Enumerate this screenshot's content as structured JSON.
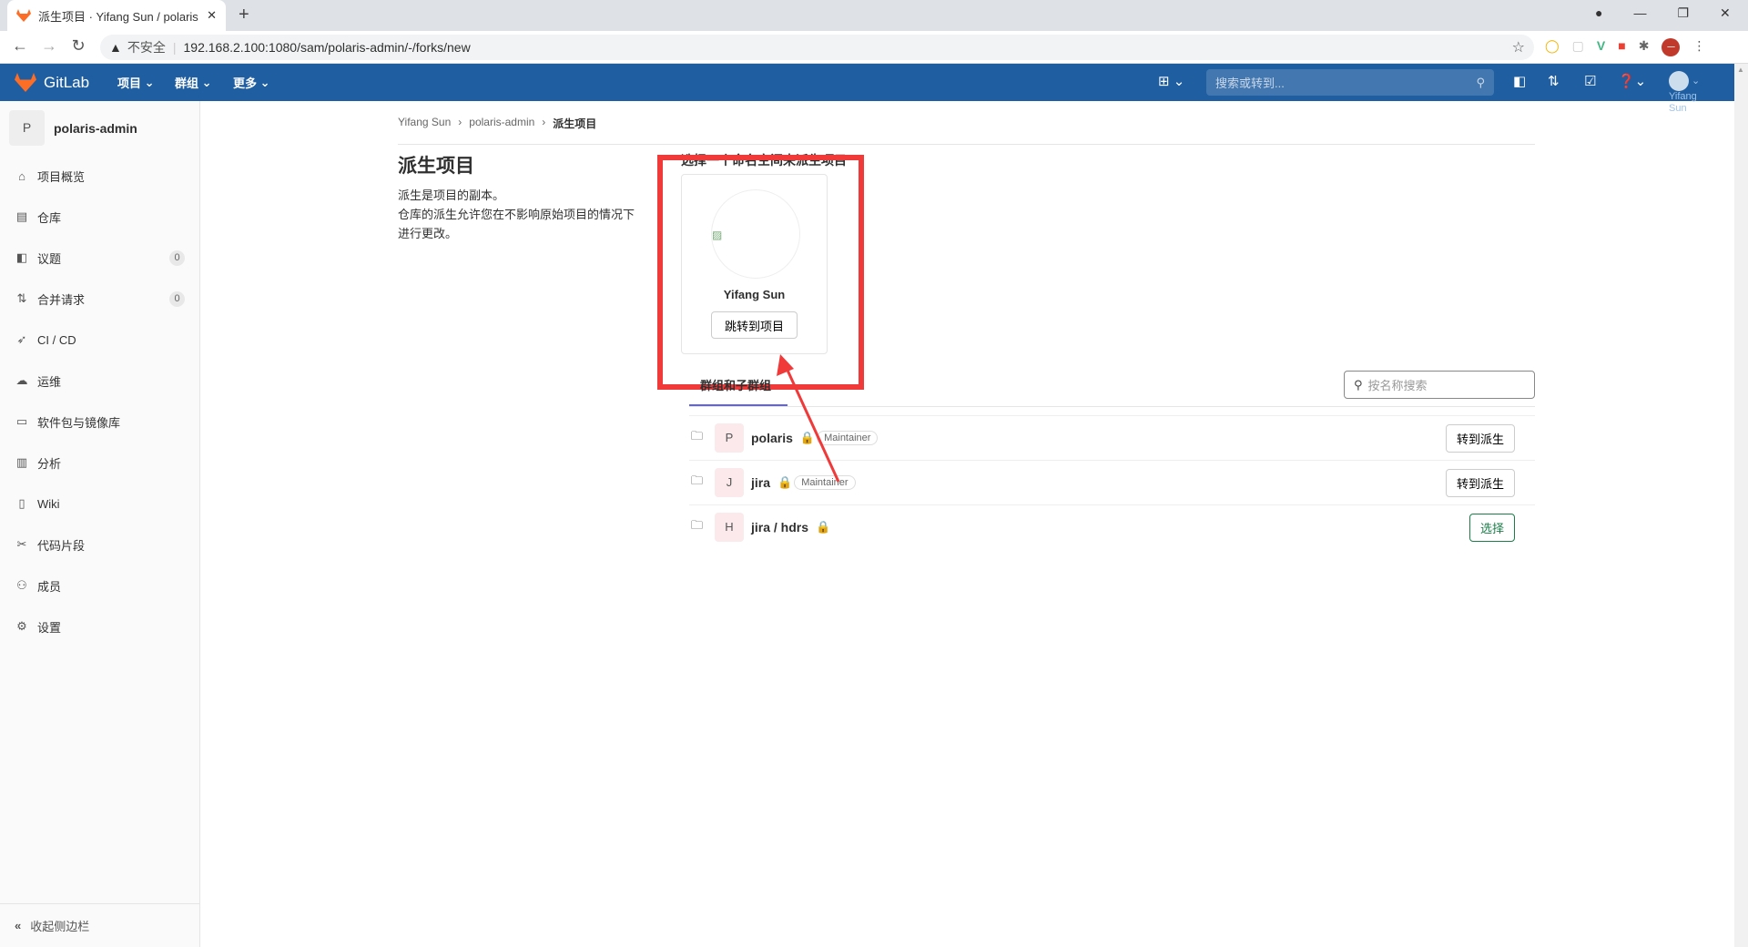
{
  "browser": {
    "tab_title": "派生项目 · Yifang Sun / polaris",
    "security": "不安全",
    "url": "192.168.2.100:1080/sam/polaris-admin/-/forks/new"
  },
  "header": {
    "brand": "GitLab",
    "menus": [
      "项目",
      "群组",
      "更多"
    ],
    "search_placeholder": "搜索或转到...",
    "user": "Yifang Sun"
  },
  "sidebar": {
    "project_letter": "P",
    "project_name": "polaris-admin",
    "items": [
      {
        "label": "项目概览",
        "icon": "home-icon"
      },
      {
        "label": "仓库",
        "icon": "doc-icon"
      },
      {
        "label": "议题",
        "icon": "issues-icon",
        "count": "0"
      },
      {
        "label": "合并请求",
        "icon": "merge-request-icon",
        "count": "0"
      },
      {
        "label": "CI / CD",
        "icon": "rocket-icon"
      },
      {
        "label": "运维",
        "icon": "cloud-icon"
      },
      {
        "label": "软件包与镜像库",
        "icon": "package-icon"
      },
      {
        "label": "分析",
        "icon": "chart-icon"
      },
      {
        "label": "Wiki",
        "icon": "book-icon"
      },
      {
        "label": "代码片段",
        "icon": "scissors-icon"
      },
      {
        "label": "成员",
        "icon": "users-icon"
      },
      {
        "label": "设置",
        "icon": "gear-icon"
      }
    ],
    "collapse": "收起侧边栏"
  },
  "breadcrumb": [
    "Yifang Sun",
    "polaris-admin",
    "派生项目"
  ],
  "page": {
    "title": "派生项目",
    "desc": [
      "派生是项目的副本。",
      "仓库的派生允许您在不影响原始项目的情况下",
      "进行更改。"
    ]
  },
  "namespace": {
    "heading": "选择一个命名空间来派生项目",
    "user_name": "Yifang Sun",
    "goto_label": "跳转到项目"
  },
  "groups": {
    "tab": "群组和子群组",
    "filter_placeholder": "按名称搜索",
    "rows": [
      {
        "letter": "P",
        "name": "polaris",
        "role": "Maintainer",
        "action": "转到派生"
      },
      {
        "letter": "J",
        "name": "jira",
        "role": "Maintainer",
        "action": "转到派生"
      },
      {
        "letter": "H",
        "name": "jira / hdrs",
        "action": "选择"
      }
    ]
  },
  "colors": {
    "header": "#1f5ea1",
    "highlight": "#f03a3a",
    "select": "#1b7d48"
  }
}
